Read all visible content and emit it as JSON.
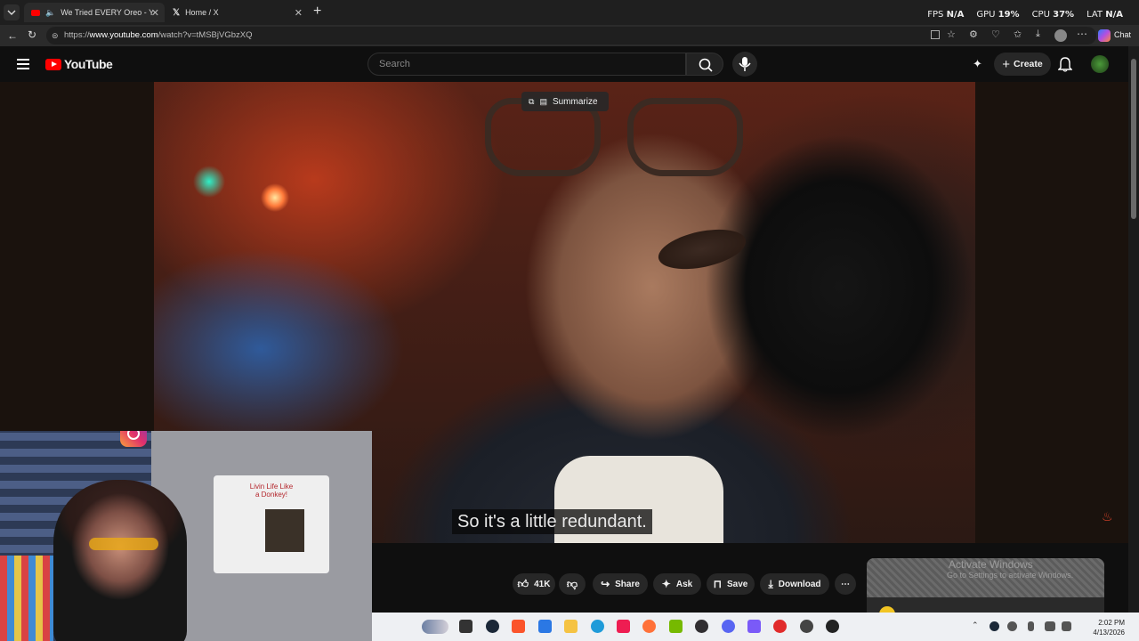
{
  "browser": {
    "tabs": [
      {
        "title": "We Tried EVERY Oreo - YouTu",
        "active": true
      },
      {
        "title": "Home / X",
        "active": false
      }
    ],
    "url_prefix": "https://",
    "url_host": "www.youtube.com",
    "url_path": "/watch?v=tMSBjVGbzXQ",
    "chat_label": "Chat"
  },
  "overlay_stats": {
    "fps_label": "FPS",
    "fps_value": "N/A",
    "gpu_label": "GPU",
    "gpu_value": "19",
    "cpu_label": "CPU",
    "cpu_value": "37",
    "lat_label": "LAT",
    "lat_value": "N/A",
    "percent": "%"
  },
  "youtube": {
    "logo_text": "YouTube",
    "search_placeholder": "Search",
    "create_label": "Create"
  },
  "video": {
    "subtitle": "So it's a little redundant.",
    "summarize_label": "Summarize"
  },
  "actions": {
    "likes": "41K",
    "share": "Share",
    "ask": "Ask",
    "save": "Save",
    "download": "Download"
  },
  "watermark": {
    "line1": "Activate Windows",
    "line2": "Go to Settings to activate Windows."
  },
  "webcam_shirt_text": "Livin Life Like a Donkey!",
  "clock": {
    "time": "2:02 PM",
    "date": "4/13/2026"
  },
  "colors": {
    "youtube_red": "#ff0000",
    "taskbar": "#eef0f3",
    "accent": "#3ea6ff"
  }
}
